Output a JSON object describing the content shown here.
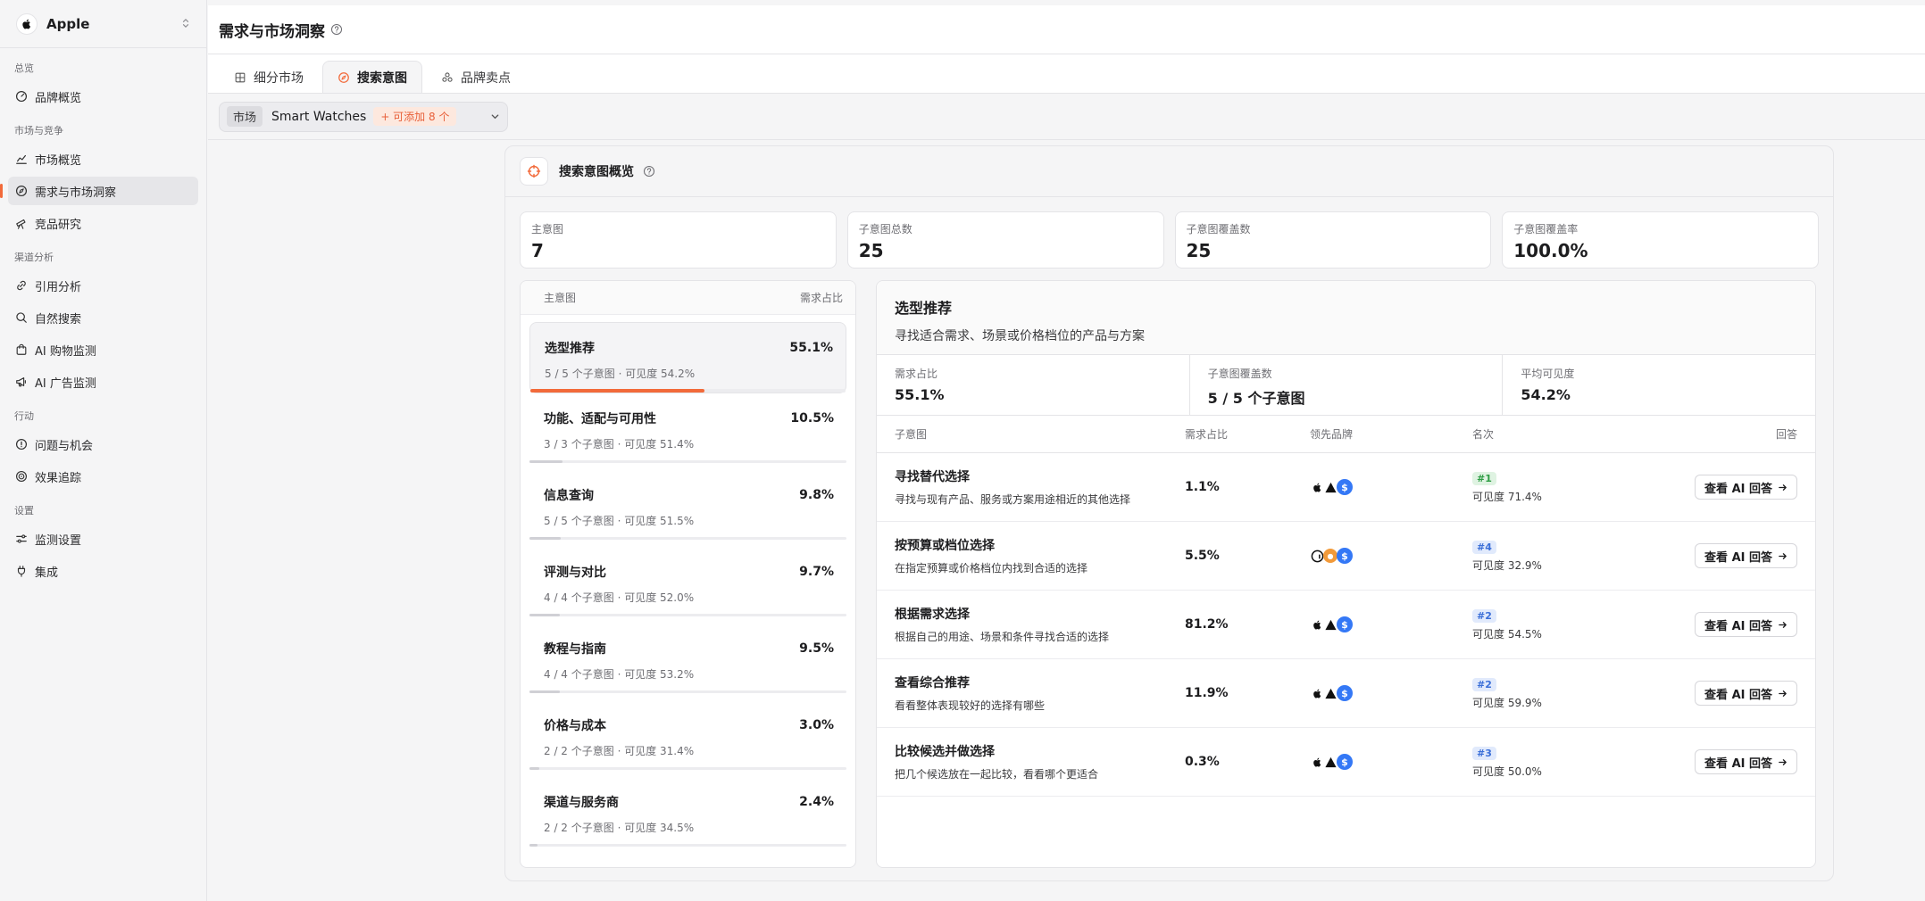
{
  "brand": {
    "name": "Apple"
  },
  "sidebar": {
    "groups": [
      {
        "label": "总览",
        "items": [
          {
            "label": "品牌概览"
          }
        ]
      },
      {
        "label": "市场与竞争",
        "items": [
          {
            "label": "市场概览"
          },
          {
            "label": "需求与市场洞察"
          },
          {
            "label": "竞品研究"
          }
        ]
      },
      {
        "label": "渠道分析",
        "items": [
          {
            "label": "引用分析"
          },
          {
            "label": "自然搜索"
          },
          {
            "label": "AI 购物监测"
          },
          {
            "label": "AI 广告监测"
          }
        ]
      },
      {
        "label": "行动",
        "items": [
          {
            "label": "问题与机会"
          },
          {
            "label": "效果追踪"
          }
        ]
      },
      {
        "label": "设置",
        "items": [
          {
            "label": "监测设置"
          },
          {
            "label": "集成"
          }
        ]
      }
    ]
  },
  "header": {
    "title": "需求与市场洞察"
  },
  "tabs": [
    {
      "label": "细分市场"
    },
    {
      "label": "搜索意图"
    },
    {
      "label": "品牌卖点"
    }
  ],
  "filter": {
    "tag": "市场",
    "value": "Smart Watches",
    "badge": "+ 可添加 8 个"
  },
  "overview": {
    "title": "搜索意图概览",
    "stats": [
      {
        "label": "主意图",
        "value": "7"
      },
      {
        "label": "子意图总数",
        "value": "25"
      },
      {
        "label": "子意图覆盖数",
        "value": "25"
      },
      {
        "label": "子意图覆盖率",
        "value": "100.0%"
      }
    ],
    "list_header": {
      "col1": "主意图",
      "col2": "需求占比"
    },
    "intents": [
      {
        "name": "选型推荐",
        "share": "55.1%",
        "sub": "5 / 5 个子意图 · 可见度 54.2%",
        "bar_pct": 55.1
      },
      {
        "name": "功能、适配与可用性",
        "share": "10.5%",
        "sub": "3 / 3 个子意图 · 可见度 51.4%",
        "bar_pct": 10.5
      },
      {
        "name": "信息查询",
        "share": "9.8%",
        "sub": "5 / 5 个子意图 · 可见度 51.5%",
        "bar_pct": 9.8
      },
      {
        "name": "评测与对比",
        "share": "9.7%",
        "sub": "4 / 4 个子意图 · 可见度 52.0%",
        "bar_pct": 9.7
      },
      {
        "name": "教程与指南",
        "share": "9.5%",
        "sub": "4 / 4 个子意图 · 可见度 53.2%",
        "bar_pct": 9.5
      },
      {
        "name": "价格与成本",
        "share": "3.0%",
        "sub": "2 / 2 个子意图 · 可见度 31.4%",
        "bar_pct": 3.0
      },
      {
        "name": "渠道与服务商",
        "share": "2.4%",
        "sub": "2 / 2 个子意图 · 可见度 34.5%",
        "bar_pct": 2.4
      }
    ]
  },
  "detail": {
    "title": "选型推荐",
    "desc": "寻找适合需求、场景或价格档位的产品与方案",
    "stats": [
      {
        "label": "需求占比",
        "value": "55.1%"
      },
      {
        "label": "子意图覆盖数",
        "value": "5 / 5 个子意图"
      },
      {
        "label": "平均可见度",
        "value": "54.2%"
      }
    ],
    "columns": {
      "name": "子意图",
      "share": "需求占比",
      "brand": "领先品牌",
      "rank": "名次",
      "answer": "回答"
    },
    "rows": [
      {
        "name": "寻找替代选择",
        "desc": "寻找与现有产品、服务或方案用途相近的其他选择",
        "share": "1.1%",
        "rank": "#1",
        "visibility": "可见度 71.4%",
        "button": "查看 AI 回答",
        "icons": [
          "apple",
          "triangle",
          "s"
        ]
      },
      {
        "name": "按预算或档位选择",
        "desc": "在指定预算或价格档位内找到合适的选择",
        "share": "5.5%",
        "rank": "#4",
        "visibility": "可见度 32.9%",
        "button": "查看 AI 回答",
        "icons": [
          "amazon",
          "orange",
          "s"
        ]
      },
      {
        "name": "根据需求选择",
        "desc": "根据自己的用途、场景和条件寻找合适的选择",
        "share": "81.2%",
        "rank": "#2",
        "visibility": "可见度 54.5%",
        "button": "查看 AI 回答",
        "icons": [
          "apple",
          "triangle",
          "s"
        ]
      },
      {
        "name": "查看综合推荐",
        "desc": "看看整体表现较好的选择有哪些",
        "share": "11.9%",
        "rank": "#2",
        "visibility": "可见度 59.9%",
        "button": "查看 AI 回答",
        "icons": [
          "apple",
          "triangle",
          "s"
        ]
      },
      {
        "name": "比较候选并做选择",
        "desc": "把几个候选放在一起比较，看看哪个更适合",
        "share": "0.3%",
        "rank": "#3",
        "visibility": "可见度 50.0%",
        "button": "查看 AI 回答",
        "icons": [
          "apple",
          "triangle",
          "s"
        ]
      }
    ]
  },
  "colors": {
    "accent": "#f26a3a",
    "blue": "#3478f6"
  }
}
